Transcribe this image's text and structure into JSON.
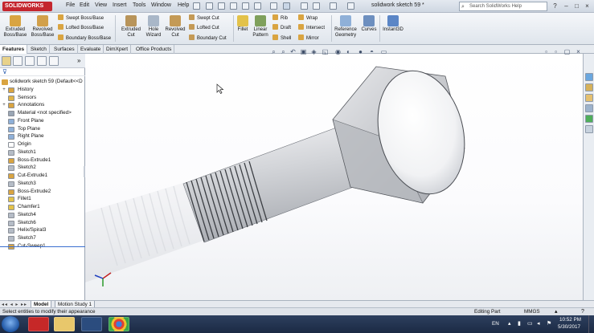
{
  "app": {
    "logo_text": "SOLIDWORKS",
    "doc_title": "solidwork sketch 59 *",
    "menus": [
      "File",
      "Edit",
      "View",
      "Insert",
      "Tools",
      "Window",
      "Help"
    ],
    "search_placeholder": "Search SolidWorks Help",
    "window_buttons": [
      "?",
      "–",
      "□",
      "×"
    ]
  },
  "ribbon": {
    "features_big": [
      {
        "line1": "Extruded",
        "line2": "Boss/Base",
        "icon": "extruded-boss-icon"
      },
      {
        "line1": "Revolved",
        "line2": "Boss/Base",
        "icon": "revolved-boss-icon"
      }
    ],
    "boss_small": [
      "Swept Boss/Base",
      "Lofted Boss/Base",
      "Boundary Boss/Base"
    ],
    "cut_big": [
      {
        "line1": "Extruded",
        "line2": "Cut",
        "icon": "extruded-cut-icon"
      },
      {
        "line1": "Hole",
        "line2": "Wizard",
        "icon": "hole-wizard-icon"
      },
      {
        "line1": "Revolved",
        "line2": "Cut",
        "icon": "revolved-cut-icon"
      }
    ],
    "cut_small": [
      "Swept Cut",
      "Lofted Cut",
      "Boundary Cut"
    ],
    "fillet": "Fillet",
    "linear_pattern": {
      "line1": "Linear",
      "line2": "Pattern"
    },
    "mid_small": [
      "Rib",
      "Draft",
      "Shell"
    ],
    "right_small": [
      "Wrap",
      "Intersect",
      "Mirror"
    ],
    "ref_geometry": {
      "line1": "Reference",
      "line2": "Geometry"
    },
    "curves": "Curves",
    "instant3d": "Instant3D"
  },
  "tabs": [
    "Features",
    "Sketch",
    "Surfaces",
    "Evaluate",
    "DimXpert",
    "Office Products"
  ],
  "tree": {
    "root": "solidwork sketch 59  (Default<<D",
    "items": [
      {
        "label": "History",
        "exp": "+",
        "color": "#d9a441"
      },
      {
        "label": "Sensors",
        "exp": "",
        "color": "#e0b347"
      },
      {
        "label": "Annotations",
        "exp": "+",
        "color": "#d9a441"
      },
      {
        "label": "Material <not specified>",
        "exp": "",
        "color": "#9aa6b4"
      },
      {
        "label": "Front Plane",
        "exp": "",
        "color": "#8fb0d8"
      },
      {
        "label": "Top Plane",
        "exp": "",
        "color": "#8fb0d8"
      },
      {
        "label": "Right Plane",
        "exp": "",
        "color": "#8fb0d8"
      },
      {
        "label": "Origin",
        "exp": "",
        "color": "#ffffff"
      },
      {
        "label": "Sketch1",
        "exp": "",
        "color": "#b5bcc6"
      },
      {
        "label": "Boss-Extrude1",
        "exp": "",
        "color": "#d9a441"
      },
      {
        "label": "Sketch2",
        "exp": "",
        "color": "#b5bcc6"
      },
      {
        "label": "Cut-Extrude1",
        "exp": "",
        "color": "#d9a441"
      },
      {
        "label": "Sketch3",
        "exp": "",
        "color": "#b5bcc6"
      },
      {
        "label": "Boss-Extrude2",
        "exp": "",
        "color": "#d9a441"
      },
      {
        "label": "Fillet1",
        "exp": "",
        "color": "#e3c24a"
      },
      {
        "label": "Chamfer1",
        "exp": "",
        "color": "#e3c24a"
      },
      {
        "label": "Sketch4",
        "exp": "",
        "color": "#b5bcc6"
      },
      {
        "label": "Sketch6",
        "exp": "",
        "color": "#b5bcc6"
      },
      {
        "label": "Helix/Spiral3",
        "exp": "",
        "color": "#b5bcc6"
      },
      {
        "label": "Sketch7",
        "exp": "",
        "color": "#b5bcc6"
      },
      {
        "label": "Cut-Sweep1",
        "exp": "",
        "color": "#d9a441"
      }
    ]
  },
  "bottom_tabs": [
    "Model",
    "Motion Study 1"
  ],
  "status": {
    "message": "Select entities to modify their appearance",
    "mode": "Editing Part",
    "units": "MMGS"
  },
  "taskbar": {
    "lang": "EN",
    "time": "10:52 PM",
    "date": "5/30/2017"
  },
  "colors": {
    "ribbon_bg": "#e8ecf1",
    "selection_blue": "#3a6fd0",
    "logo_red": "#c4262e",
    "taskbar_bg": "#1f2f4c"
  }
}
